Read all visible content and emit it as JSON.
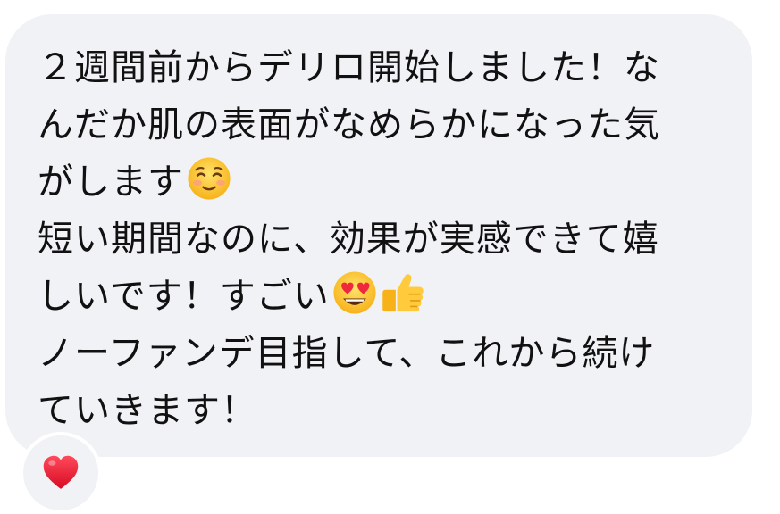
{
  "message": {
    "lines": [
      "２週間前からデリロ開始しました！な",
      "んだか肌の表面がなめらかになった気",
      "がします",
      "短い期間なのに、効果が実感できて嬉",
      "しいです！すごい",
      "ノーファンデ目指して、これから続け",
      "ていきます！"
    ],
    "emojis": {
      "line3": "smiling-face-emoji",
      "line5_a": "heart-eyes-emoji",
      "line5_b": "thumbs-up-emoji"
    }
  },
  "reaction": {
    "icon": "red-heart-icon",
    "color": "#e0102a"
  },
  "colors": {
    "bubble": "#f1f2f6",
    "text": "#111111"
  }
}
